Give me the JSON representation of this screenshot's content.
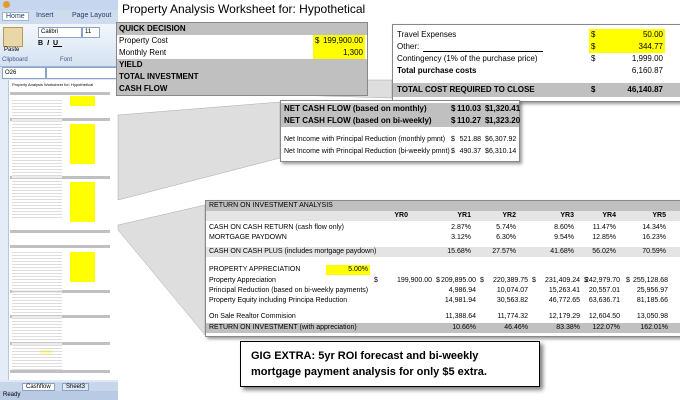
{
  "excel": {
    "tabs": [
      "Home",
      "Insert",
      "Page Layout"
    ],
    "font_name": "Calibri",
    "font_size": "11",
    "paste_label": "Paste",
    "clipboard_label": "Clipboard",
    "font_label": "Font",
    "name_box": "O26",
    "mini_title": "Property Analysis Worksheet for: Hypothetical",
    "sheet_tabs": [
      "Cashflow",
      "Sheet3"
    ],
    "status": "Ready"
  },
  "title": "Property Analysis Worksheet for: Hypothetical",
  "decision": {
    "header": "QUICK DECISION",
    "property_cost_label": "Property Cost",
    "property_cost_currency": "$",
    "property_cost_value": "199,900.00",
    "monthly_rent_label": "Monthly Rent",
    "monthly_rent_value": "1,300",
    "yield_label": "YIELD",
    "total_investment_label": "TOTAL INVESTMENT",
    "cash_flow_label": "CASH FLOW"
  },
  "purchase": {
    "rows": [
      {
        "label": "Travel Expenses",
        "currency": "$",
        "value": "50.00",
        "highlight": true
      },
      {
        "label": "Other:",
        "currency": "$",
        "value": "344.77",
        "highlight": true
      },
      {
        "label": "Contingency (1% of the purchase price)",
        "currency": "$",
        "value": "1,999.00",
        "highlight": false
      },
      {
        "label": "Total purchase costs",
        "currency": "",
        "value": "6,160.87",
        "highlight": false
      }
    ],
    "total_label": "TOTAL COST REQUIRED TO CLOSE",
    "total_currency": "$",
    "total_value": "46,140.87"
  },
  "cashflow": {
    "monthly_label": "NET CASH FLOW (based on monthly)",
    "monthly_a": "110.03",
    "monthly_b": "1,320.41",
    "biweekly_label": "NET CASH FLOW (based on bi-weekly)",
    "biweekly_a": "110.27",
    "biweekly_b": "1,323.20",
    "ni_monthly_label": "Net Income with Principal Reduction (monthly pmnt)",
    "ni_monthly_a": "521.88",
    "ni_monthly_b": "6,307.92",
    "ni_biweekly_label": "Net Income with Principal Reduction (bi-weekly pmnt)",
    "ni_biweekly_a": "490.37",
    "ni_biweekly_b": "6,310.14",
    "currency": "$"
  },
  "roi": {
    "header": "RETURN ON INVESTMENT ANALYSIS",
    "years": [
      "YR0",
      "YR1",
      "YR2",
      "YR3",
      "YR4",
      "YR5"
    ],
    "coc_label": "CASH ON CASH RETURN (cash flow only)",
    "coc": [
      "",
      "2.87%",
      "5.74%",
      "8.60%",
      "11.47%",
      "14.34%"
    ],
    "mort_label": "MORTGAGE PAYDOWN",
    "mort": [
      "",
      "3.12%",
      "6.30%",
      "9.54%",
      "12.85%",
      "16.23%"
    ],
    "cocplus_label": "CASH ON CASH PLUS (includes mortgage paydown)",
    "cocplus": [
      "",
      "15.68%",
      "27.57%",
      "41.68%",
      "56.02%",
      "70.59%"
    ],
    "appr_label": "PROPERTY APPRECIATION",
    "appr_rate": "5.00%",
    "pa_label": "Property Appreciation",
    "pa": [
      "199,900.00",
      "209,895.00",
      "220,389.75",
      "231,409.24",
      "242,979.70",
      "255,128.68"
    ],
    "pr_label": "Principal Reduction (based on bi-weekly payments)",
    "pr": [
      "",
      "4,986.94",
      "10,074.07",
      "15,263.41",
      "20,557.01",
      "25,956.97"
    ],
    "pe_label": "Property Equity including Principa Reduction",
    "pe": [
      "",
      "14,981.94",
      "30,563.82",
      "46,772.65",
      "63,636.71",
      "81,185.66"
    ],
    "sale_label": "On Sale Realtor Commision",
    "sale": [
      "",
      "11,388.64",
      "11,774.32",
      "12,179.29",
      "12,604.50",
      "13,050.98"
    ],
    "roi_label": "RETURN ON INVESTMENT (with appreciation)",
    "roi_vals": [
      "",
      "10.66%",
      "46.46%",
      "83.38%",
      "122.07%",
      "162.01%"
    ],
    "currency": "$"
  },
  "banner": "GIG EXTRA: 5yr ROI forecast and bi-weekly mortgage payment analysis for only $5 extra.",
  "colors": {
    "highlight": "#ffff00",
    "header_gray": "#c0c0c0",
    "excel_blue": "#dfe8f5"
  }
}
